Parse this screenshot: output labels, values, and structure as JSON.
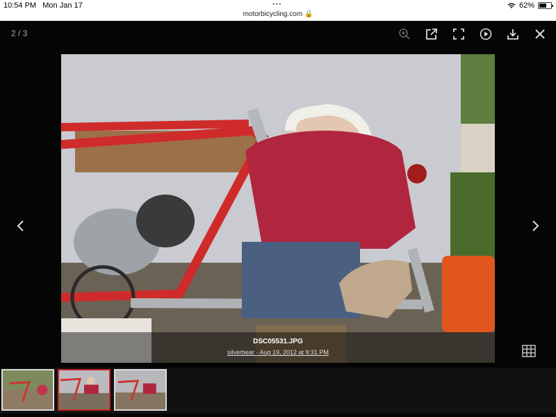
{
  "status": {
    "time": "10:54 PM",
    "date": "Mon Jan 17",
    "url": "motorbicycling.com",
    "battery": "62%",
    "battery_level": 0.62
  },
  "viewer": {
    "counter": "2 / 3",
    "photo_label": "DSC05531.JPG",
    "photo_meta": "silverbear · Aug 19, 2012 at 9:31 PM",
    "toolbar": [
      "zoom-in-icon",
      "share-icon",
      "fullscreen-icon",
      "play-icon",
      "download-icon",
      "close-icon"
    ],
    "thumbnails": [
      "thumb-1",
      "thumb-2",
      "thumb-3"
    ],
    "active_thumb": 2
  },
  "colors": {
    "accent": "#cc2222",
    "frame_red": "#d42a2a"
  }
}
